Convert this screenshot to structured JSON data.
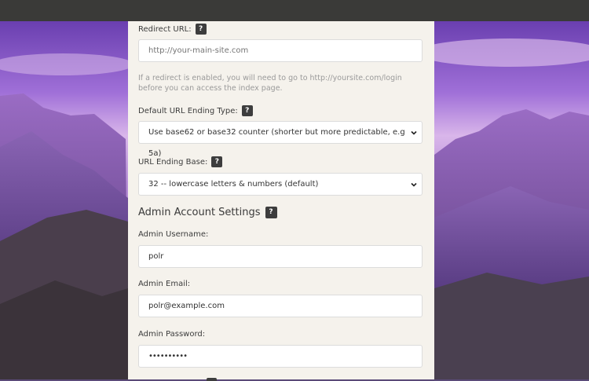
{
  "form": {
    "redirect_url": {
      "label": "Redirect URL:",
      "placeholder": "http://your-main-site.com",
      "help": "?"
    },
    "redirect_hint": "If a redirect is enabled, you will need to go to http://yoursite.com/login before you can access the index page.",
    "url_ending_type": {
      "label": "Default URL Ending Type:",
      "value": "Use base62 or base32 counter (shorter but more predictable, e.g 5a)",
      "help": "?"
    },
    "url_ending_base": {
      "label": "URL Ending Base:",
      "value": "32 -- lowercase letters & numbers (default)",
      "help": "?"
    },
    "admin_section": {
      "title": "Admin Account Settings",
      "help": "?"
    },
    "admin_username": {
      "label": "Admin Username:",
      "value": "polr"
    },
    "admin_email": {
      "label": "Admin Email:",
      "value": "polr@example.com"
    },
    "admin_password": {
      "label": "Admin Password:",
      "value": "••••••••••"
    }
  },
  "colors": {
    "topbar": "#3a3a38",
    "panel": "#f5f2ec",
    "help_badge": "#3d3d3d"
  }
}
